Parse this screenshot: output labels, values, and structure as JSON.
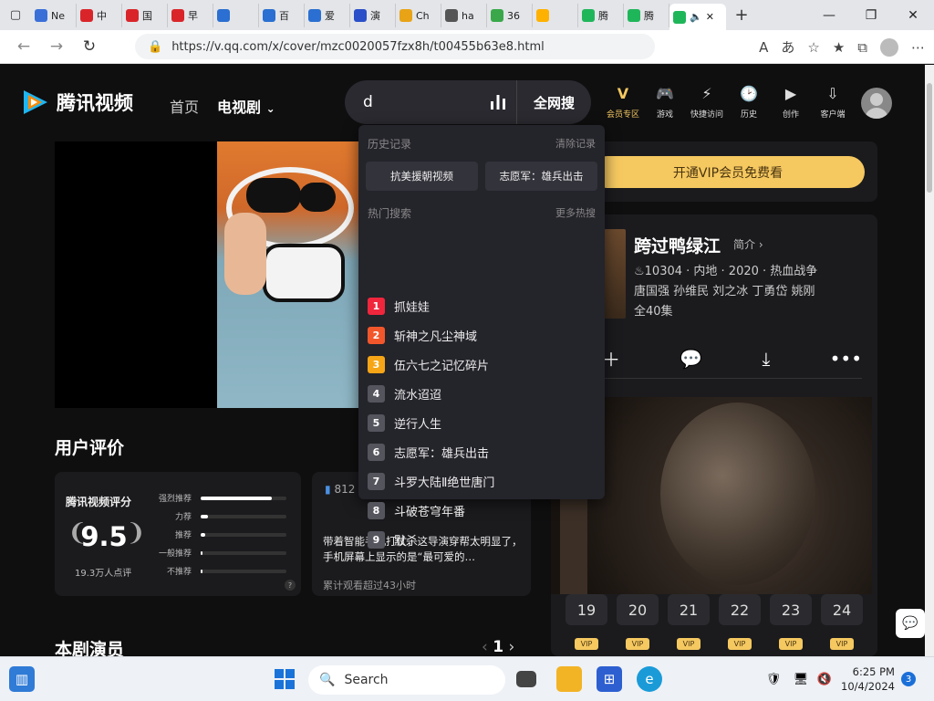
{
  "browser": {
    "tabs": [
      {
        "label": "Ne",
        "color": "#3b6fd8"
      },
      {
        "label": "中",
        "color": "#d9252a"
      },
      {
        "label": "国",
        "color": "#d9252a"
      },
      {
        "label": "早",
        "color": "#d9252a"
      },
      {
        "label": "",
        "color": "#2a6fd1"
      },
      {
        "label": "百",
        "color": "#2a6fd1"
      },
      {
        "label": "爱",
        "color": "#2a6fd1"
      },
      {
        "label": "演",
        "color": "#2a4fc9"
      },
      {
        "label": "Ch",
        "color": "#e8a317"
      },
      {
        "label": "ha",
        "color": "#555555"
      },
      {
        "label": "36",
        "color": "#3aa84a"
      },
      {
        "label": "",
        "color": "#ffb100"
      },
      {
        "label": "腾",
        "color": "#1fb65a"
      },
      {
        "label": "腾",
        "color": "#1fb65a"
      }
    ],
    "url": "https://v.qq.com/x/cover/mzc0020057fzx8h/t00455b63e8.html"
  },
  "site": {
    "logo_text": "腾讯视频",
    "nav_home": "首页",
    "nav_tv": "电视剧",
    "search_value": "d",
    "search_button": "全网搜",
    "top_icons": [
      {
        "glyph": "V",
        "label": "会员专区",
        "color": "#f5c860"
      },
      {
        "glyph": "🎮",
        "label": "游戏",
        "color": "#dddddd"
      },
      {
        "glyph": "⚡",
        "label": "快捷访问",
        "color": "#dddddd"
      },
      {
        "glyph": "🕑",
        "label": "历史",
        "color": "#dddddd"
      },
      {
        "glyph": "▶",
        "label": "创作",
        "color": "#dddddd"
      },
      {
        "glyph": "⇩",
        "label": "客户端",
        "color": "#dddddd"
      }
    ]
  },
  "dropdown": {
    "history_title": "历史记录",
    "clear_label": "清除记录",
    "history_items": [
      "抗美援朝视频",
      "志愿军：雄兵出击"
    ],
    "hot_title": "热门搜索",
    "more_label": "更多热搜",
    "hot_items": [
      {
        "rank": "1",
        "label": "抓娃娃",
        "color": "#f0263d"
      },
      {
        "rank": "2",
        "label": "斩神之凡尘神域",
        "color": "#f2572b"
      },
      {
        "rank": "3",
        "label": "伍六七之记忆碎片",
        "color": "#f5a516"
      },
      {
        "rank": "4",
        "label": "流水迢迢",
        "color": "#55555e"
      },
      {
        "rank": "5",
        "label": "逆行人生",
        "color": "#55555e"
      },
      {
        "rank": "6",
        "label": "志愿军：雄兵出击",
        "color": "#55555e"
      },
      {
        "rank": "7",
        "label": "斗罗大陆Ⅱ绝世唐门",
        "color": "#55555e"
      },
      {
        "rank": "8",
        "label": "斗破苍穹年番",
        "color": "#55555e"
      },
      {
        "rank": "9",
        "label": "默杀",
        "color": "#55555e"
      }
    ]
  },
  "side": {
    "vip_button": "开通VIP会员免费看",
    "title": "跨过鸭绿江",
    "intro": "简介",
    "meta_line1": "♨10304 · 内地 · 2020 · 热血战争",
    "meta_line2": "唐国强 孙维民 刘之冰 丁勇岱 姚刚",
    "meta_line3": "全40集",
    "episodes": [
      "19",
      "20",
      "21",
      "22",
      "23",
      "24"
    ],
    "vip_badge": "VIP"
  },
  "reviews": {
    "section_title": "用户评价",
    "rating_title": "腾讯视频评分",
    "score": "9.5",
    "count": "19.3万人点评",
    "rows": [
      {
        "label": "强烈推荐",
        "fraction": 0.83
      },
      {
        "label": "力荐",
        "fraction": 0.09
      },
      {
        "label": "推荐",
        "fraction": 0.05
      },
      {
        "label": "一般推荐",
        "fraction": 0.01
      },
      {
        "label": "不推荐",
        "fraction": 0.01
      }
    ],
    "help": "?",
    "review_num": "812",
    "review_text": "带着智能手机打仗，这导演穿帮太明显了，手机屏幕上显示的是“最可爱的…",
    "review_sub": "累计观看超过43小时"
  },
  "cast": {
    "title": "本剧演员",
    "page": "1"
  },
  "taskbar": {
    "search_placeholder": "Search",
    "time": "6:25 PM",
    "date": "10/4/2024",
    "notifications": "3"
  }
}
